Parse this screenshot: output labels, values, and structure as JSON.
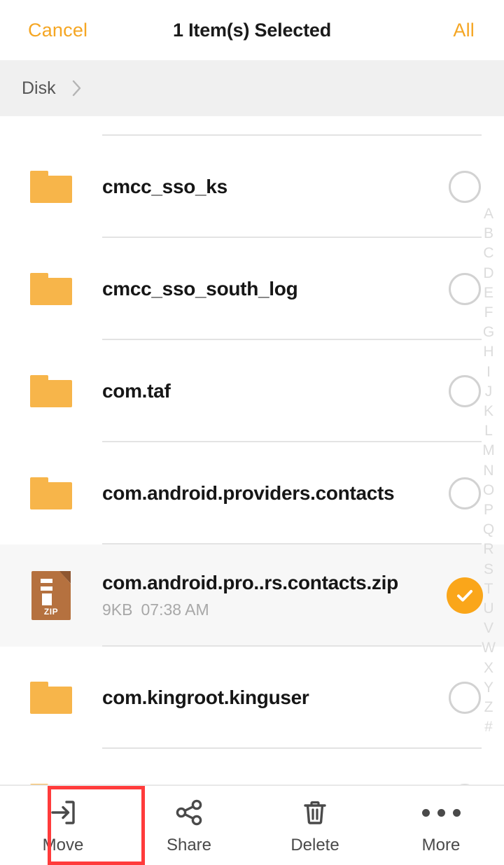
{
  "topbar": {
    "cancel_label": "Cancel",
    "title": "1 Item(s) Selected",
    "all_label": "All",
    "accent_color": "#F5A623"
  },
  "breadcrumb": {
    "items": [
      "Disk"
    ],
    "separator": "›"
  },
  "list": {
    "rows": [
      {
        "name": "cmcc_sso_ks",
        "type": "folder",
        "meta": "",
        "selected": false
      },
      {
        "name": "cmcc_sso_south_log",
        "type": "folder",
        "meta": "",
        "selected": false
      },
      {
        "name": "com.taf",
        "type": "folder",
        "meta": "",
        "selected": false
      },
      {
        "name": "com.android.providers.contacts",
        "type": "folder",
        "meta": "",
        "selected": false
      },
      {
        "name": "com.android.pro..rs.contacts.zip",
        "type": "zip",
        "size": "9KB",
        "time": "07:38 AM",
        "selected": true
      },
      {
        "name": "com.kingroot.kinguser",
        "type": "folder",
        "meta": "",
        "selected": false
      }
    ],
    "zip_badge": "ZIP",
    "folder_color": "#F7B54A",
    "zip_color": "#B5713F",
    "selected_check_color": "#FAA61A"
  },
  "alpha_index": [
    "A",
    "B",
    "C",
    "D",
    "E",
    "F",
    "G",
    "H",
    "I",
    "J",
    "K",
    "L",
    "M",
    "N",
    "O",
    "P",
    "Q",
    "R",
    "S",
    "T",
    "U",
    "V",
    "W",
    "X",
    "Y",
    "Z",
    "#"
  ],
  "bottombar": {
    "items": [
      {
        "label": "Move",
        "icon": "move-icon"
      },
      {
        "label": "Share",
        "icon": "share-icon"
      },
      {
        "label": "Delete",
        "icon": "trash-icon"
      },
      {
        "label": "More",
        "icon": "more-icon"
      }
    ],
    "highlight_color": "#FF3B3B"
  }
}
